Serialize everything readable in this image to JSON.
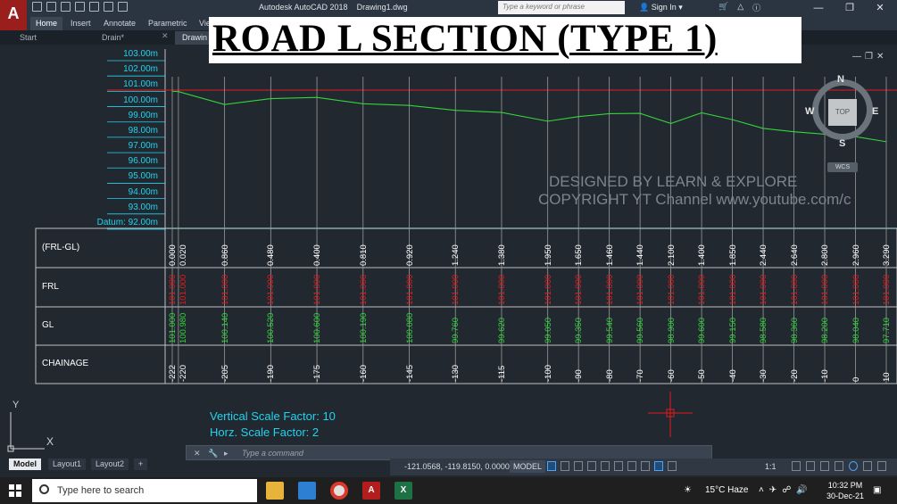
{
  "titlebar": {
    "app_name": "Autodesk AutoCAD 2018",
    "file_name": "Drawing1.dwg",
    "search_placeholder": "Type a keyword or phrase",
    "sign_in": "Sign In",
    "app_logo": "A"
  },
  "ribbon": {
    "tabs": [
      "Home",
      "Insert",
      "Annotate",
      "Parametric",
      "Vie"
    ]
  },
  "doc_tabs": {
    "tabs": [
      "Start",
      "Drain*",
      "Drawin"
    ]
  },
  "drawing": {
    "title": "ROAD L SECTION (TYPE 1)",
    "elevations": [
      "103.00m",
      "102.00m",
      "101.00m",
      "100.00m",
      "99.00m",
      "98.00m",
      "97.00m",
      "96.00m",
      "95.00m",
      "94.00m",
      "93.00m",
      "Datum: 92.00m"
    ],
    "rows": [
      "(FRL-GL)",
      "FRL",
      "GL",
      "CHAINAGE"
    ],
    "columns": [
      {
        "diff": "0.000",
        "frl": "101.000",
        "gl": "101.000",
        "ch": "-222"
      },
      {
        "diff": "0.020",
        "frl": "101.000",
        "gl": "100.980",
        "ch": "-220"
      },
      {
        "diff": "0.860",
        "frl": "101.000",
        "gl": "100.140",
        "ch": "-205"
      },
      {
        "diff": "0.480",
        "frl": "101.000",
        "gl": "100.520",
        "ch": "-190"
      },
      {
        "diff": "0.400",
        "frl": "101.000",
        "gl": "100.600",
        "ch": "-175"
      },
      {
        "diff": "0.810",
        "frl": "101.000",
        "gl": "100.190",
        "ch": "-160"
      },
      {
        "diff": "0.920",
        "frl": "101.000",
        "gl": "100.080",
        "ch": "-145"
      },
      {
        "diff": "1.240",
        "frl": "101.000",
        "gl": "99.760",
        "ch": "-130"
      },
      {
        "diff": "1.380",
        "frl": "101.000",
        "gl": "99.620",
        "ch": "-115"
      },
      {
        "diff": "1.950",
        "frl": "101.000",
        "gl": "99.050",
        "ch": "-100"
      },
      {
        "diff": "1.650",
        "frl": "101.000",
        "gl": "99.350",
        "ch": "-90"
      },
      {
        "diff": "1.460",
        "frl": "101.000",
        "gl": "99.540",
        "ch": "-80"
      },
      {
        "diff": "1.440",
        "frl": "101.000",
        "gl": "99.560",
        "ch": "-70"
      },
      {
        "diff": "2.100",
        "frl": "101.000",
        "gl": "98.900",
        "ch": "-60"
      },
      {
        "diff": "1.400",
        "frl": "101.000",
        "gl": "99.600",
        "ch": "-50"
      },
      {
        "diff": "1.850",
        "frl": "101.000",
        "gl": "99.150",
        "ch": "-40"
      },
      {
        "diff": "2.440",
        "frl": "101.000",
        "gl": "98.580",
        "ch": "-30"
      },
      {
        "diff": "2.640",
        "frl": "101.000",
        "gl": "98.360",
        "ch": "-20"
      },
      {
        "diff": "2.800",
        "frl": "101.000",
        "gl": "98.200",
        "ch": "-10"
      },
      {
        "diff": "2.960",
        "frl": "101.000",
        "gl": "98.040",
        "ch": "0"
      },
      {
        "diff": "3.290",
        "frl": "101.000",
        "gl": "97.710",
        "ch": "10"
      }
    ],
    "watermark_1": "DESIGNED BY LEARN & EXPLORE",
    "watermark_2": "COPYRIGHT YT Channel www.youtube.com/c",
    "vertical_scale": "Vertical Scale Factor: 10",
    "horizontal_scale": "Horz. Scale Factor: 2",
    "ucs_y": "Y",
    "ucs_x": "X"
  },
  "viewcube": {
    "n": "N",
    "s": "S",
    "e": "E",
    "w": "W",
    "top": "TOP",
    "wcs": "WCS"
  },
  "command_line": {
    "placeholder": "Type a command"
  },
  "layout_tabs": [
    "Model",
    "Layout1",
    "Layout2",
    "+"
  ],
  "statusbar": {
    "coords": "-121.0568, -119.8150, 0.0000",
    "model": "MODEL",
    "scale": "1:1"
  },
  "taskbar": {
    "search_placeholder": "Type here to search",
    "weather": "15°C  Haze",
    "time": "10:32 PM",
    "date": "30-Dec-21"
  },
  "colors": {
    "frl_red": "#e21b1b",
    "gl_green": "#35d43c",
    "cyan": "#22d3ee",
    "bg": "#212830"
  }
}
